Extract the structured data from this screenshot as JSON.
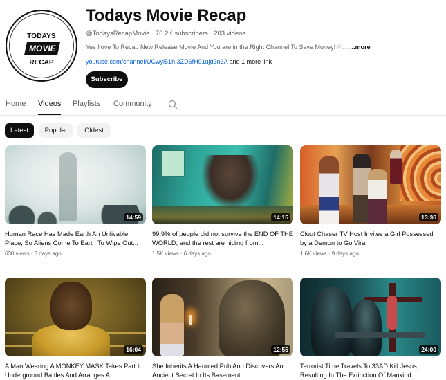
{
  "channel": {
    "avatar": {
      "line1": "TODAYS",
      "line2": "MOVIE",
      "line3": "RECAP"
    },
    "name": "Todays Movie Recap",
    "handle": "@TodaysRecapMovie",
    "subscribers": "76.2K subscribers",
    "videos_count": "203 videos",
    "separator": "‧",
    "description": "Yes Ilove To Recap New Release Movie And You are in the Right Channel To Save Money!",
    "description_fade": " PL...",
    "more_label": "...more",
    "link_url": "youtube.com/channel/UCwyi51hI3ZD6fH91ujd3n3A",
    "link_extra": " and 1 more link",
    "subscribe_label": "Subscribe"
  },
  "tabs": [
    {
      "label": "Home",
      "active": false
    },
    {
      "label": "Videos",
      "active": true
    },
    {
      "label": "Playlists",
      "active": false
    },
    {
      "label": "Community",
      "active": false
    }
  ],
  "search_icon": "search-icon",
  "filters": [
    {
      "label": "Latest",
      "active": true
    },
    {
      "label": "Popular",
      "active": false
    },
    {
      "label": "Oldest",
      "active": false
    }
  ],
  "videos": [
    {
      "title": "Human Race Has Made Earth An Unlivable Place, So Aliens Come To Earth To Wipe Out...",
      "views": "630 views",
      "age": "3 days ago",
      "duration": "14:59"
    },
    {
      "title": "99.9% of people did not survive the END OF THE WORLD, and the rest are hiding from...",
      "views": "1.5K views",
      "age": "6 days ago",
      "duration": "14:15"
    },
    {
      "title": "Clout Chaser TV Host Invites a Girl Possessed by a Demon to Go Viral",
      "views": "1.6K views",
      "age": "9 days ago",
      "duration": "13:36"
    },
    {
      "title": "A Man Wearing A MONKEY MASK Takes Part In Underground Battles And Arranges A...",
      "views": "",
      "age": "",
      "duration": "16:04"
    },
    {
      "title": "She Inherits A Haunted Pub And Discovers An Ancient Secret In Its Basement",
      "views": "",
      "age": "",
      "duration": "12:55"
    },
    {
      "title": "Terrorist Time Travels To 33AD Kill Jesus, Resulting In The Extinction Of Mankind",
      "views": "",
      "age": "",
      "duration": "24:00"
    }
  ]
}
